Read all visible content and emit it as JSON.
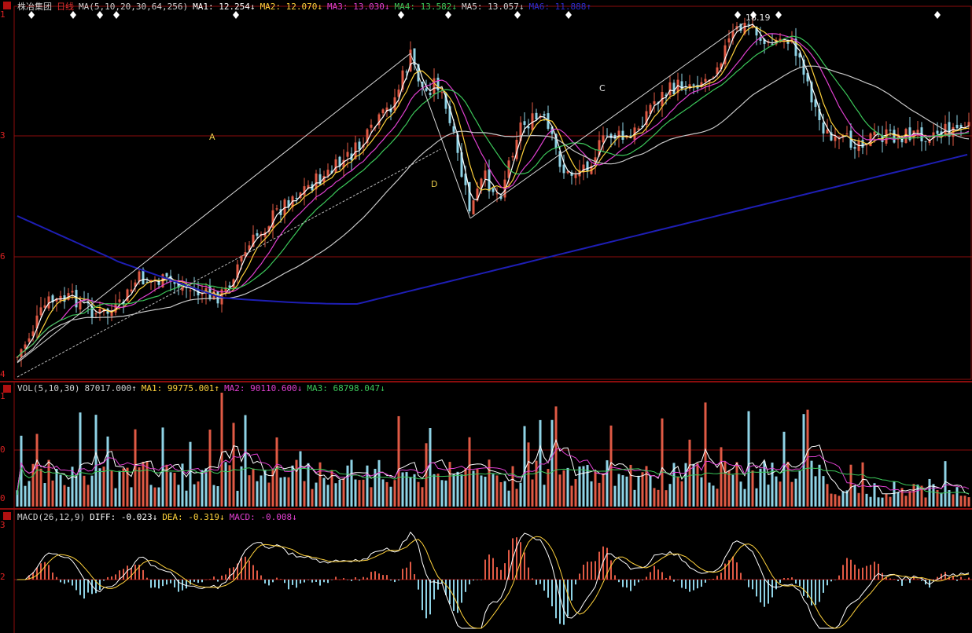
{
  "colors": {
    "background": "#000000",
    "grid": "#8b0d0d",
    "candle_up": "#e05a45",
    "candle_down": "#8fd3e6",
    "ma1": "#ffffff",
    "ma2": "#ffd23c",
    "ma3": "#e040d0",
    "ma4": "#3cc85a",
    "ma5": "#c8c8c8",
    "ma6": "#1e1eb4",
    "label": "#e6c84a"
  },
  "main_panel": {
    "stock_name": "株冶集团",
    "period": "日线",
    "header": [
      {
        "text": "MA(5,10,20,30,64,256)",
        "color": "#cfcfcf"
      },
      {
        "text": "MA1: 12.254↓",
        "color": "#ffffff"
      },
      {
        "text": "MA2: 12.070↓",
        "color": "#ffd23c"
      },
      {
        "text": "MA3: 13.030↓",
        "color": "#e040d0"
      },
      {
        "text": "MA4: 13.582↓",
        "color": "#3cc85a"
      },
      {
        "text": "MA5: 13.057↓",
        "color": "#cfcfcf"
      },
      {
        "text": "MA6: 11.888↑",
        "color": "#2c2cd0"
      }
    ],
    "axis_labels": [
      "1",
      "3",
      "6",
      "4"
    ],
    "peak_label": "18.19",
    "annotations": [
      "A",
      "C",
      "D"
    ],
    "diamond_icon": "diamond-marker-icon"
  },
  "volume_panel": {
    "header": [
      {
        "text": "VOL(5,10,30)",
        "color": "#cfcfcf"
      },
      {
        "text": "87017.000↑",
        "color": "#cfcfcf"
      },
      {
        "text": "MA1: 99775.001↑",
        "color": "#ffd23c"
      },
      {
        "text": "MA2: 90110.600↓",
        "color": "#e040d0"
      },
      {
        "text": "MA3: 68798.047↓",
        "color": "#3cc85a"
      }
    ],
    "axis_labels": [
      "1",
      "0",
      "0"
    ]
  },
  "macd_panel": {
    "header": [
      {
        "text": "MACD(26,12,9)",
        "color": "#cfcfcf"
      },
      {
        "text": "DIFF: -0.023↓",
        "color": "#ffffff"
      },
      {
        "text": "DEA: -0.319↓",
        "color": "#ffd23c"
      },
      {
        "text": "MACD: -0.008↓",
        "color": "#e040d0"
      }
    ],
    "axis_labels": [
      "3",
      "2"
    ]
  }
}
